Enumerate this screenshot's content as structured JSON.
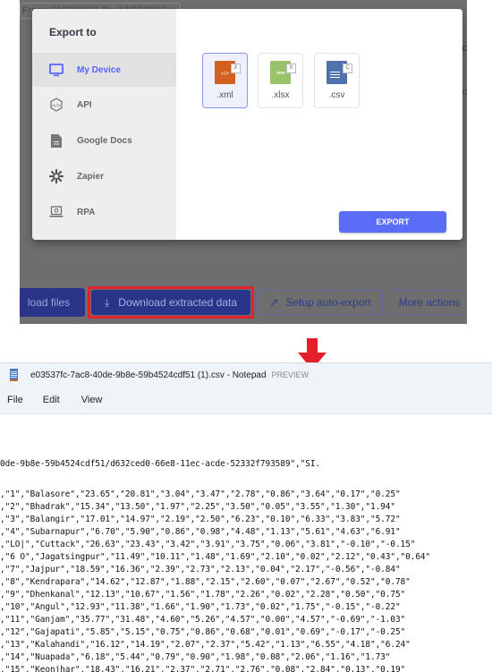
{
  "background_app": {
    "date_filter": "From: 11/27/2021  To: 12/27/2021  ∨",
    "right_text_1": "ec",
    "right_text_2": "D:"
  },
  "export_modal": {
    "title": "Export to",
    "sidebar": [
      {
        "label": "My Device",
        "icon": "monitor-icon",
        "active": true
      },
      {
        "label": "API",
        "icon": "api-code-icon",
        "active": false
      },
      {
        "label": "Google Docs",
        "icon": "document-icon",
        "active": false
      },
      {
        "label": "Zapier",
        "icon": "zapier-asterisk-icon",
        "active": false
      },
      {
        "label": "RPA",
        "icon": "rpa-laptop-icon",
        "active": false
      }
    ],
    "formats": [
      {
        "ext": ".xml",
        "badge": "X",
        "glyph": "</>",
        "color": "#d35f1f",
        "selected": true
      },
      {
        "ext": ".xlsx",
        "badge": "X",
        "glyph": "≡≡≡",
        "color": "#99c36a",
        "selected": false
      },
      {
        "ext": ".csv",
        "badge": "C",
        "glyph": "≡",
        "color": "#4f72ae",
        "selected": false
      }
    ],
    "export_button": "EXPORT",
    "accent_color": "#5b6cf7"
  },
  "action_bar": {
    "upload_files": "load files",
    "download_extracted": "Download extracted data",
    "setup_auto_export": "Setup auto-export",
    "more_actions": "More actions",
    "highlight_color": "#e5202b"
  },
  "notepad": {
    "title": "e03537fc-7ac8-40de-9b8e-59b4524cdf51 (1).csv - Notepad",
    "preview_label": "PREVIEW",
    "menu": [
      "File",
      "Edit",
      "View"
    ],
    "lines": [
      "0de-9b8e-59b4524cdf51/d632ced0-66e8-11ec-acde-52332f793589\",\"SI.",
      ",\"1\",\"Balasore\",\"23.65\",\"20.81\",\"3.04\",\"3.47\",\"2.78\",\"0.86\",\"3.64\",\"0.17\",\"0.25\"",
      ",\"2\",\"Bhadrak\",\"15.34\",\"13.50\",\"1.97\",\"2.25\",\"3.50\",\"0.05\",\"3.55\",\"1.30\",\"1.94\"",
      ",\"3\",\"Balangir\",\"17.01\",\"14.97\",\"2.19\",\"2.50\",\"6.23\",\"0.10\",\"6.33\",\"3.83\",\"5.72\"",
      ",\"4\",\"Subarnapur\",\"6.70\",\"5.90\",\"0.86\",\"0.98\",\"4.48\",\"1.13\",\"5.61\",\"4.63\",\"6.91\"",
      ",\"LO|\",\"Cuttack\",\"26.63\",\"23.43\",\"3.42\",\"3.91\",\"3.75\",\"0.06\",\"3.81\",\"-0.10\",\"-0.15\"",
      ",\"6 O\",\"Jagatsingpur\",\"11.49\",\"10.11\",\"1.48\",\"1.69\",\"2.10\",\"0.02\",\"2.12\",\"0.43\",\"0.64\"",
      ",\"7\",\"Jajpur\",\"18.59\",\"16.36\",\"2.39\",\"2.73\",\"2.13\",\"0.04\",\"2.17\",\"-0.56\",\"-0.84\"",
      ",\"8\",\"Kendrapara\",\"14.62\",\"12.87\",\"1.88\",\"2.15\",\"2.60\",\"0.07\",\"2.67\",\"0.52\",\"0.78\"",
      ",\"9\",\"Dhenkanal\",\"12.13\",\"10.67\",\"1.56\",\"1.78\",\"2.26\",\"0.02\",\"2.28\",\"0.50\",\"0.75\"",
      ",\"10\",\"Angul\",\"12.93\",\"11.38\",\"1.66\",\"1.90\",\"1.73\",\"0.02\",\"1.75\",\"-0.15\",\"-0.22\"",
      ",\"11\",\"Ganjam\",\"35.77\",\"31.48\",\"4.60\",\"5.26\",\"4.57\",\"0.00\",\"4.57\",\"-0.69\",\"-1.03\"",
      ",\"12\",\"Gajapati\",\"5.85\",\"5.15\",\"0.75\",\"0.86\",\"0.68\",\"0.01\",\"0.69\",\"-0.17\",\"-0.25\"",
      ",\"13\",\"Kalahandi\",\"16.12\",\"14.19\",\"2.07\",\"2.37\",\"5.42\",\"1.13\",\"6.55\",\"4.18\",\"6.24\"",
      ",\"14\",\"Nuapada\",\"6.18\",\"5.44\",\"0.79\",\"0.90\",\"1.98\",\"0.08\",\"2.06\",\"1.16\",\"1.73\"",
      ",\"15\",\"Keonjhar\",\"18.43\",\"16.21\",\"2.37\",\"2.71\",\"2.76\",\"0.08\",\"2.84\",\"0.13\",\"0.19\""
    ]
  }
}
